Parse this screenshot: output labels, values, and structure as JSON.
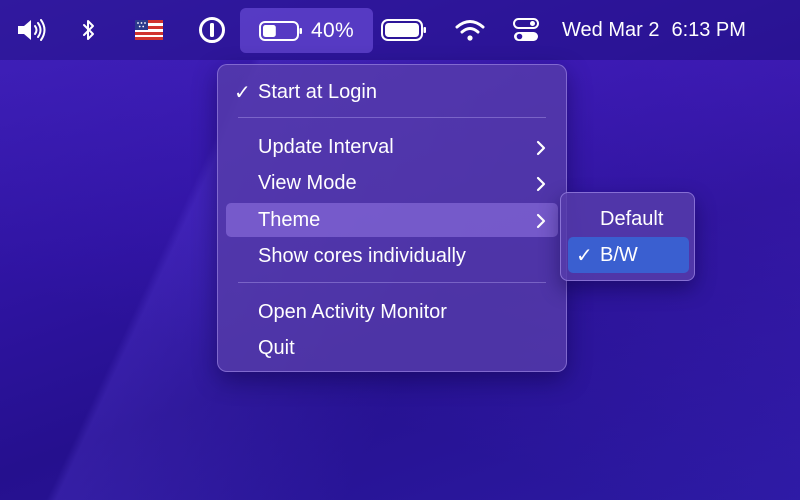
{
  "menubar": {
    "icons": {
      "volume": "speaker-volume-icon",
      "bluetooth": "bluetooth-icon",
      "input_source": "us-flag-icon",
      "password_manager": "onepassword-icon",
      "battery_stats": "battery-indicator-icon",
      "battery": "battery-icon",
      "wifi": "wifi-icon",
      "control_center": "control-center-icon"
    },
    "battery_percent_label": "40%",
    "battery_level": 0.4,
    "clock": {
      "date": "Wed Mar 2",
      "time": "6:13 PM"
    }
  },
  "menu": {
    "items": [
      {
        "label": "Start at Login",
        "checked": true,
        "has_submenu": false
      },
      {
        "label": "Update Interval",
        "checked": false,
        "has_submenu": true
      },
      {
        "label": "View Mode",
        "checked": false,
        "has_submenu": true
      },
      {
        "label": "Theme",
        "checked": false,
        "has_submenu": true,
        "highlighted": true
      },
      {
        "label": "Show cores individually",
        "checked": false,
        "has_submenu": false
      },
      {
        "label": "Open Activity Monitor",
        "checked": false,
        "has_submenu": false
      },
      {
        "label": "Quit",
        "checked": false,
        "has_submenu": false
      }
    ],
    "check_glyph": "✓"
  },
  "theme_submenu": {
    "items": [
      {
        "label": "Default",
        "checked": false
      },
      {
        "label": "B/W",
        "checked": true,
        "selected": true
      }
    ],
    "check_glyph": "✓"
  },
  "colors": {
    "desktop": "#2f14a2",
    "selection": "#3a5fd0",
    "menu_highlight": "#8c6fe0"
  }
}
